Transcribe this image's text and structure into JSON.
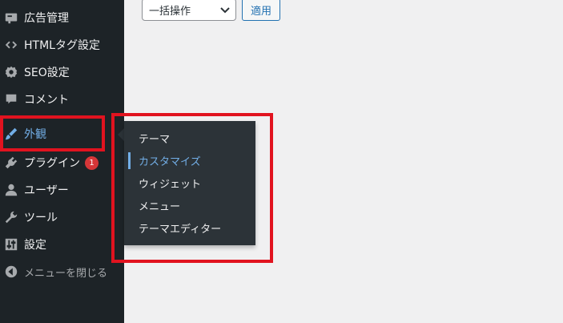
{
  "sidebar": {
    "items": [
      {
        "label": "広告管理",
        "icon": "ad-icon"
      },
      {
        "label": "HTMLタグ設定",
        "icon": "code-icon"
      },
      {
        "label": "SEO設定",
        "icon": "gear-icon"
      },
      {
        "label": "コメント",
        "icon": "comment-icon"
      },
      {
        "label": "外観",
        "icon": "paintbrush-icon",
        "current": true
      },
      {
        "label": "プラグイン",
        "icon": "plugin-icon",
        "badge": "1"
      },
      {
        "label": "ユーザー",
        "icon": "user-icon"
      },
      {
        "label": "ツール",
        "icon": "wrench-icon"
      },
      {
        "label": "設定",
        "icon": "settings-sliders-icon"
      },
      {
        "label": "メニューを閉じる",
        "icon": "collapse-arrow-icon"
      }
    ]
  },
  "flyout": {
    "items": [
      {
        "label": "テーマ"
      },
      {
        "label": "カスタマイズ",
        "active": true
      },
      {
        "label": "ウィジェット"
      },
      {
        "label": "メニュー"
      },
      {
        "label": "テーマエディター"
      }
    ]
  },
  "toolbar": {
    "bulk_action": "一括操作",
    "apply_label": "適用"
  },
  "colors": {
    "sidebar_bg": "#1d2327",
    "flyout_bg": "#2c3338",
    "accent": "#72aee6",
    "highlight_box": "#e1131f",
    "badge": "#d63638"
  }
}
